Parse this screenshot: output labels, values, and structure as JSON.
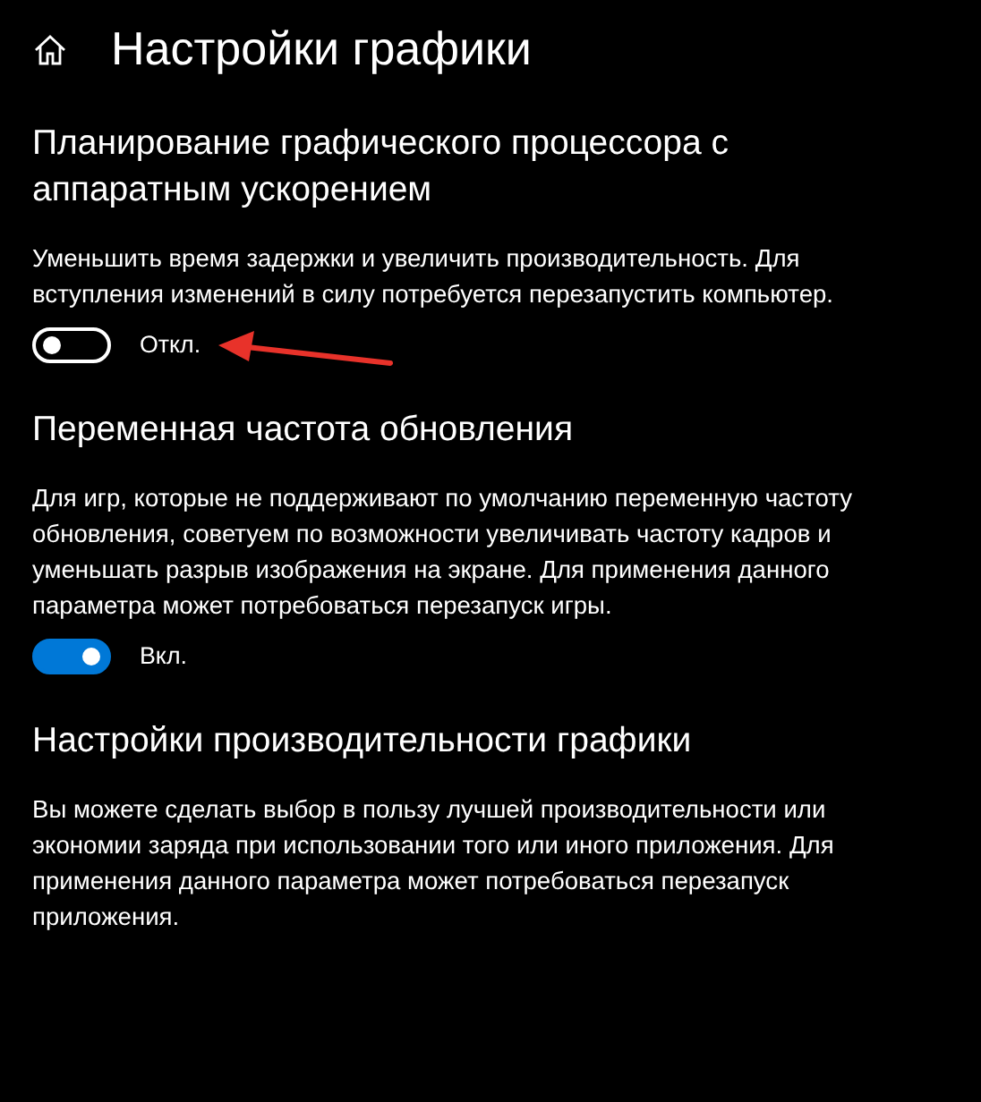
{
  "page": {
    "title": "Настройки графики"
  },
  "sections": [
    {
      "heading": "Планирование графического процессора с аппаратным ускорением",
      "description": "Уменьшить время задержки и увеличить производительность. Для вступления изменений в силу потребуется перезапустить компьютер.",
      "toggle": {
        "on": false,
        "label": "Откл.",
        "annotated": true
      }
    },
    {
      "heading": "Переменная частота обновления",
      "description": "Для игр, которые не поддерживают по умолчанию переменную частоту обновления, советуем по возможности увеличивать частоту кадров и уменьшать разрыв изображения на экране. Для применения данного параметра может потребоваться перезапуск игры.",
      "toggle": {
        "on": true,
        "label": "Вкл.",
        "annotated": false
      }
    },
    {
      "heading": "Настройки производительности графики",
      "description": "Вы можете сделать выбор в пользу лучшей производительности или экономии заряда при использовании того или иного приложения. Для применения данного параметра может потребоваться перезапуск приложения."
    }
  ]
}
